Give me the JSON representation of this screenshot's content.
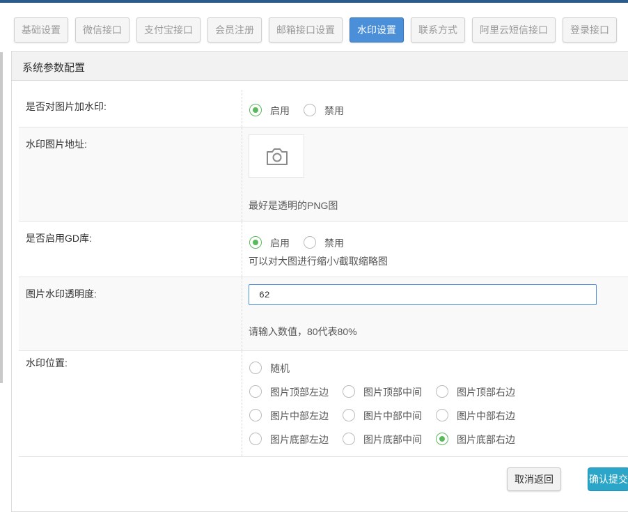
{
  "tabs": [
    {
      "label": "基础设置",
      "active": false
    },
    {
      "label": "微信接口",
      "active": false
    },
    {
      "label": "支付宝接口",
      "active": false
    },
    {
      "label": "会员注册",
      "active": false
    },
    {
      "label": "邮箱接口设置",
      "active": false
    },
    {
      "label": "水印设置",
      "active": true
    },
    {
      "label": "联系方式",
      "active": false
    },
    {
      "label": "阿里云短信接口",
      "active": false
    },
    {
      "label": "登录接口",
      "active": false
    }
  ],
  "panel": {
    "title": "系统参数配置"
  },
  "form": {
    "watermark_enable": {
      "label": "是否对图片加水印:",
      "options": [
        "启用",
        "禁用"
      ],
      "selected": "启用"
    },
    "watermark_image": {
      "label": "水印图片地址:",
      "upload_icon": "camera-icon",
      "hint": "最好是透明的PNG图"
    },
    "gd_enable": {
      "label": "是否启用GD库:",
      "options": [
        "启用",
        "禁用"
      ],
      "selected": "启用",
      "hint": "可以对大图进行缩小/截取缩略图"
    },
    "opacity": {
      "label": "图片水印透明度:",
      "value": "62",
      "hint": "请输入数值，80代表80%"
    },
    "position": {
      "label": "水印位置:",
      "options": [
        "随机",
        "图片顶部左边",
        "图片顶部中间",
        "图片顶部右边",
        "图片中部左边",
        "图片中部中间",
        "图片中部右边",
        "图片底部左边",
        "图片底部中间",
        "图片底部右边"
      ],
      "selected": "图片底部右边"
    }
  },
  "actions": {
    "cancel": "取消返回",
    "submit": "确认提交"
  },
  "colors": {
    "accent": "#4a8fd8",
    "radio_checked": "#5cb85c",
    "submit": "#2ba6c9"
  }
}
